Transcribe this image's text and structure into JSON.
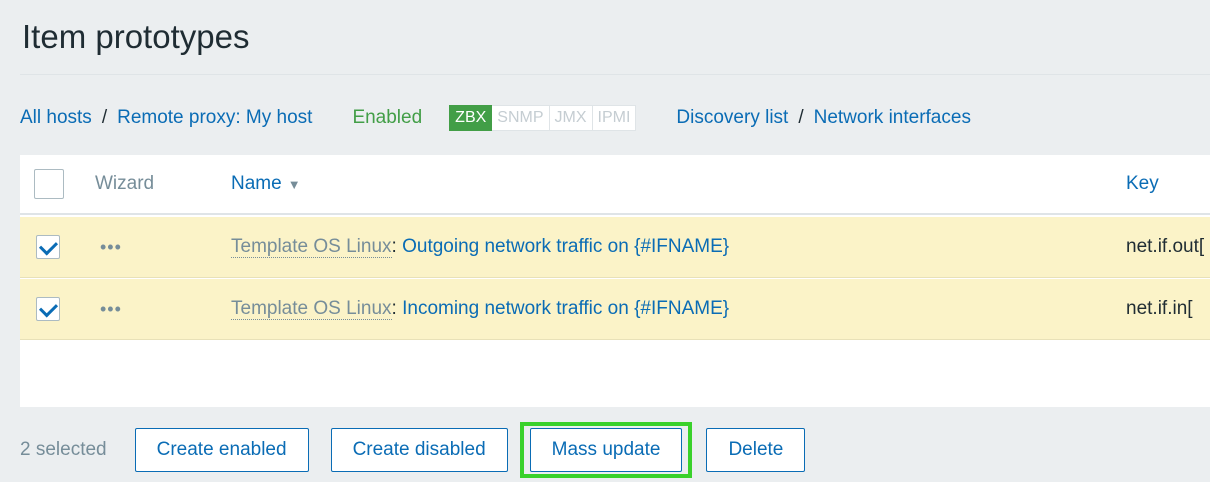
{
  "page": {
    "title": "Item prototypes"
  },
  "breadcrumb": {
    "all_hosts": "All hosts",
    "sep": "/",
    "host": "Remote proxy: My host",
    "status": "Enabled",
    "interfaces": [
      "ZBX",
      "SNMP",
      "JMX",
      "IPMI"
    ],
    "discovery_list": "Discovery list",
    "discovery_rule": "Network interfaces"
  },
  "table": {
    "headers": {
      "wizard": "Wizard",
      "name": "Name",
      "key": "Key"
    },
    "rows": [
      {
        "template": "Template OS Linux",
        "colon": ":",
        "name": "Outgoing network traffic on {#IFNAME}",
        "key": "net.if.out[",
        "wizard": "•••"
      },
      {
        "template": "Template OS Linux",
        "colon": ":",
        "name": "Incoming network traffic on {#IFNAME}",
        "key": "net.if.in[",
        "wizard": "•••"
      }
    ]
  },
  "footer": {
    "selected": "2 selected",
    "create_enabled": "Create enabled",
    "create_disabled": "Create disabled",
    "mass_update": "Mass update",
    "delete": "Delete"
  },
  "colors": {
    "link": "#0a6cb5",
    "enabled": "#429e47",
    "row_selected": "#fbf3c8",
    "highlight": "#39d12b"
  }
}
